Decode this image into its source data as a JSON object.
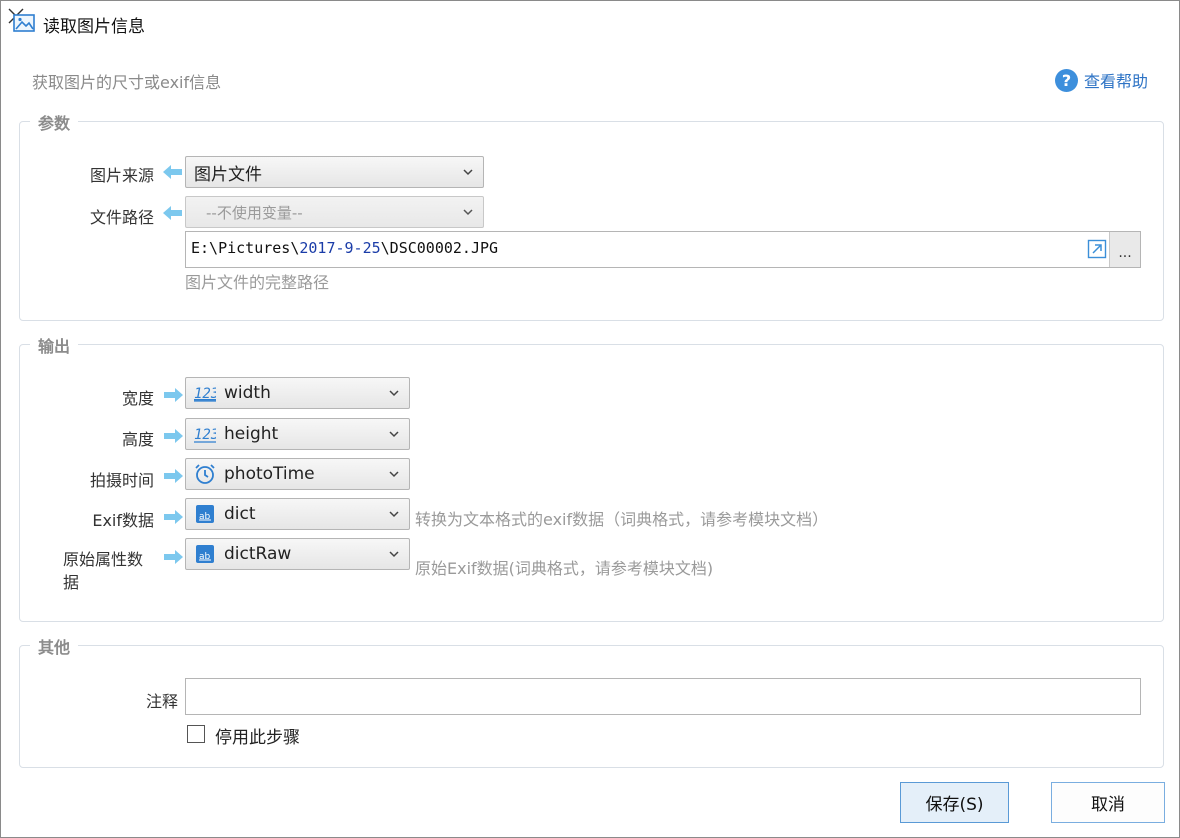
{
  "window": {
    "title": "读取图片信息",
    "subtitle": "获取图片的尺寸或exif信息",
    "help_label": "查看帮助"
  },
  "params": {
    "group_title": "参数",
    "source_label": "图片来源",
    "source_value": "图片文件",
    "path_label": "文件路径",
    "path_variable": "--不使用变量--",
    "path_prefix": "E:\\Pictures\\",
    "path_date": "2017-9-25",
    "path_suffix": "\\DSC00002.JPG",
    "path_hint": "图片文件的完整路径",
    "browse_label": "..."
  },
  "output": {
    "group_title": "输出",
    "rows": [
      {
        "label": "宽度",
        "icon": "number-icon",
        "value": "width",
        "hint": ""
      },
      {
        "label": "高度",
        "icon": "number-icon",
        "value": "height",
        "hint": ""
      },
      {
        "label": "拍摄时间",
        "icon": "alarm-clock-icon",
        "value": "photoTime",
        "hint": ""
      },
      {
        "label": "Exif数据",
        "icon": "dict-icon",
        "value": "dict",
        "hint": "转换为文本格式的exif数据（词典格式，请参考模块文档）"
      },
      {
        "label": "原始属性数据",
        "icon": "dict-icon",
        "value": "dictRaw",
        "hint": "原始Exif数据(词典格式，请参考模块文档)"
      }
    ]
  },
  "other": {
    "group_title": "其他",
    "comment_label": "注释",
    "comment_value": "",
    "disable_label": "停用此步骤",
    "disable_checked": false
  },
  "buttons": {
    "save": "保存(S)",
    "cancel": "取消"
  },
  "colors": {
    "accent": "#2d73c5",
    "arrow": "#6ec6f0",
    "save_bg": "#e4eff9"
  }
}
